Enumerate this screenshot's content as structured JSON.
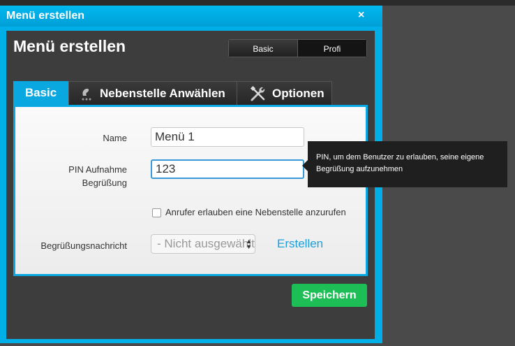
{
  "dialog": {
    "title": "Menü erstellen",
    "close_label": "×",
    "heading": "Menü erstellen",
    "mode_toggle": {
      "basic": "Basic",
      "profi": "Profi"
    }
  },
  "tabs": [
    {
      "label": "Basic",
      "icon": "none"
    },
    {
      "label": "Nebenstelle Anwählen",
      "icon": "dial-icon"
    },
    {
      "label": "Optionen",
      "icon": "tools-icon"
    }
  ],
  "form": {
    "name_label": "Name",
    "name_value": "Menü 1",
    "pin_label_line1": "PIN Aufnahme",
    "pin_label_line2": "Begrüßung",
    "pin_value": "123",
    "checkbox_label": "Anrufer erlauben eine Nebenstelle anzurufen",
    "checkbox_checked": false,
    "greeting_label": "Begrüßungsnachricht",
    "greeting_select_value": "- Nicht ausgewählt -",
    "create_link": "Erstellen"
  },
  "save_label": "Speichern",
  "tooltip": {
    "line1": "PIN, um dem Benutzer zu erlauben, seine eigene",
    "line2": "Begrüßung aufzunehmen"
  },
  "colors": {
    "accent": "#00aee8",
    "save_green": "#1dbe55",
    "dark_body": "#3d3d3d",
    "tooltip_bg": "#1f1f1f"
  }
}
